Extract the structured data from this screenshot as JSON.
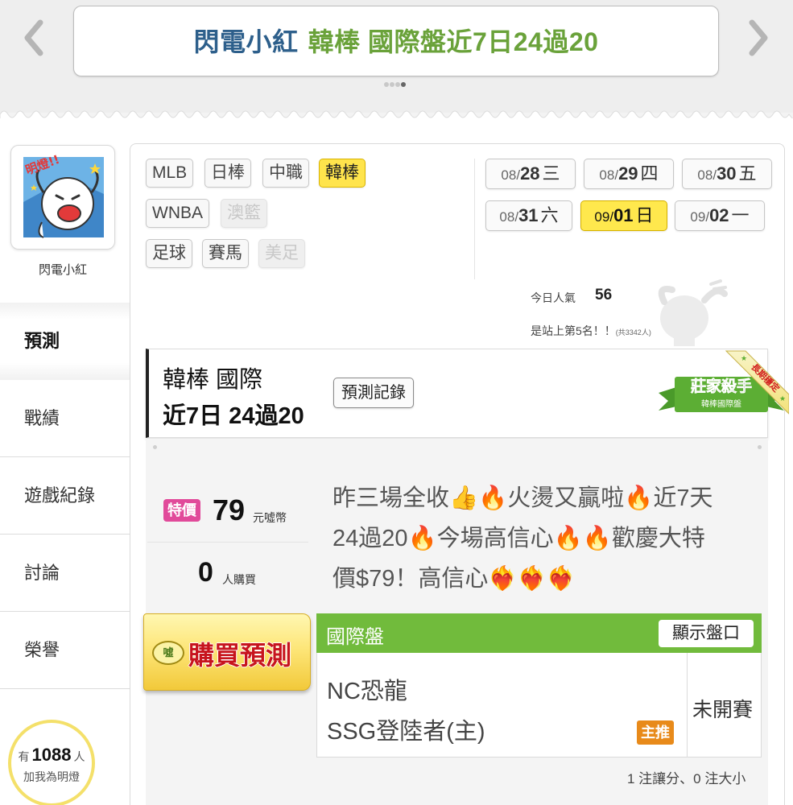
{
  "banner": {
    "name": "閃電小紅",
    "title": "韓棒 國際盤近7日24過20",
    "slide_count": 4,
    "active_slide": 4
  },
  "profile": {
    "name": "閃電小紅",
    "avatar_text": "明燈!!"
  },
  "sidebar": {
    "items": [
      {
        "label": "預測",
        "active": true
      },
      {
        "label": "戰績",
        "active": false
      },
      {
        "label": "遊戲紀錄",
        "active": false
      },
      {
        "label": "討論",
        "active": false
      },
      {
        "label": "榮譽",
        "active": false
      }
    ]
  },
  "fans": {
    "prefix": "有",
    "count": "1088",
    "suffix": "人",
    "line2": "加我為明燈"
  },
  "sports": [
    {
      "label": "MLB",
      "state": "normal"
    },
    {
      "label": "日棒",
      "state": "normal"
    },
    {
      "label": "中職",
      "state": "normal"
    },
    {
      "label": "韓棒",
      "state": "active"
    },
    {
      "label": "WNBA",
      "state": "normal"
    },
    {
      "label": "澳籃",
      "state": "disabled"
    },
    {
      "label": "足球",
      "state": "normal"
    },
    {
      "label": "賽馬",
      "state": "normal"
    },
    {
      "label": "美足",
      "state": "disabled"
    }
  ],
  "dates": [
    {
      "month": "08/",
      "day": "28",
      "weekday": "三",
      "active": false
    },
    {
      "month": "08/",
      "day": "29",
      "weekday": "四",
      "active": false
    },
    {
      "month": "08/",
      "day": "30",
      "weekday": "五",
      "active": false
    },
    {
      "month": "08/",
      "day": "31",
      "weekday": "六",
      "active": false
    },
    {
      "month": "09/",
      "day": "01",
      "weekday": "日",
      "active": true
    },
    {
      "month": "09/",
      "day": "02",
      "weekday": "一",
      "active": false
    }
  ],
  "popularity": {
    "label": "今日人氣",
    "value": "56",
    "rank_text": "是站上第5名！！",
    "rank_total": "(共3342人)"
  },
  "pick_header": {
    "line1": "韓棒 國際",
    "line2": "近7日 24過20",
    "record_button": "預測記錄",
    "badge_title": "莊家殺手",
    "badge_subtitle": "韓棒國際盤",
    "ribbon_text": "長期穩定"
  },
  "pricing": {
    "tag": "特價",
    "price": "79",
    "unit": "元噓幣",
    "buyers": "0",
    "buyers_unit": "人購買"
  },
  "analysis": {
    "line1": "昨三場全收👍🔥火燙又贏啦🔥近7天",
    "line2": "24過20🔥今場高信心🔥🔥歡慶大特",
    "line3": "價$79！高信心❤️‍🔥❤️‍🔥❤️‍🔥"
  },
  "buy_button": {
    "coin_label": "噓",
    "label": "購買預測"
  },
  "market": {
    "title": "國際盤",
    "show_odds_button": "顯示盤口",
    "away_team": "NC恐龍",
    "home_team": "SSG登陸者(主)",
    "main_pick_badge": "主推",
    "status": "未開賽",
    "summary": "1 注讓分、0 注大小"
  },
  "colors": {
    "banner_name": "#2d5f8b",
    "banner_title": "#6aa23a",
    "market_header": "#71bb3c",
    "price_tag": "#e14a9a",
    "buy_text": "#c7141d",
    "active_tag": "#ffe44c",
    "main_pick": "#e88a1a"
  }
}
